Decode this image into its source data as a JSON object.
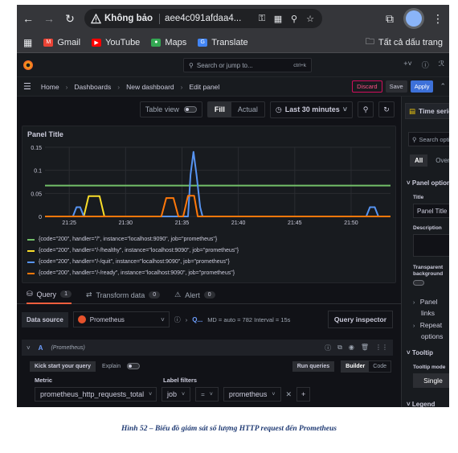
{
  "browser": {
    "security_label": "Không bảo",
    "url": "aee4c091afdaa4...",
    "icons": [
      "back-icon",
      "forward-icon",
      "reload-icon",
      "warning-icon",
      "key-icon",
      "translate-icon",
      "zoom-icon",
      "star-icon",
      "extensions-icon",
      "profile-icon",
      "menu-icon"
    ],
    "bookmarks": [
      {
        "label": "Gmail",
        "color": "#ea4335"
      },
      {
        "label": "YouTube",
        "color": "#ff0000"
      },
      {
        "label": "Maps",
        "color": "#34a853"
      },
      {
        "label": "Translate",
        "color": "#4285f4"
      }
    ],
    "all_bookmarks": "Tất cả dấu trang"
  },
  "grafana": {
    "search_placeholder": "Search or jump to...",
    "search_shortcut": "ctrl+k",
    "breadcrumb": [
      "Home",
      "Dashboards",
      "New dashboard",
      "Edit panel"
    ],
    "actions": {
      "discard": "Discard",
      "save": "Save",
      "apply": "Apply"
    }
  },
  "panel_toolbar": {
    "table_view": "Table view",
    "fill": "Fill",
    "actual": "Actual",
    "time_range": "Last 30 minutes"
  },
  "panel": {
    "title": "Panel Title"
  },
  "chart_data": {
    "type": "line",
    "title": "Panel Title",
    "y_ticks": [
      "0.15",
      "0.1",
      "0.05",
      "0"
    ],
    "x_ticks": [
      "21:25",
      "21:30",
      "21:35",
      "21:40",
      "21:45",
      "21:50"
    ],
    "ylim": [
      0,
      0.15
    ],
    "xlim": [
      0,
      28.5
    ],
    "grid": true,
    "legend_position": "bottom",
    "series": [
      {
        "name": "{code=\"200\", handler=\"/\", instance=\"localhost:9090\", job=\"prometheus\"}",
        "color": "#73bf69",
        "x": [
          0,
          28.5
        ],
        "y": [
          0.067,
          0.067
        ]
      },
      {
        "name": "{code=\"200\", handler=\"/-/healthy\", instance=\"localhost:9090\", job=\"prometheus\"}",
        "color": "#fade2a",
        "x": [
          0,
          3.2,
          3.6,
          4.5,
          4.9,
          9.3
        ],
        "y": [
          0,
          0,
          0.044,
          0.044,
          0,
          0
        ]
      },
      {
        "name": "{code=\"200\", handler=\"/-/quit\", instance=\"localhost:9090\", job=\"prometheus\"}",
        "color": "#5794f2",
        "x": [
          0,
          2.3,
          2.6,
          2.9,
          3.2,
          11.8,
          12.0,
          12.25,
          12.5,
          12.8,
          13.0,
          26.5,
          26.8,
          27.2,
          27.5,
          28.5
        ],
        "y": [
          0,
          0,
          0.02,
          0.02,
          0,
          0,
          0.09,
          0.14,
          0.09,
          0.02,
          0,
          0,
          0.02,
          0.02,
          0,
          0
        ]
      },
      {
        "name": "{code=\"200\", handler=\"/-/ready\", instance=\"localhost:9090\", job=\"prometheus\"}",
        "color": "#ff780a",
        "x": [
          0,
          9.6,
          10.0,
          10.6,
          11.0,
          11.4,
          11.8,
          12.3,
          12.6,
          28.5
        ],
        "y": [
          0,
          0,
          0.04,
          0.04,
          0,
          0,
          0.045,
          0.045,
          0,
          0
        ]
      }
    ]
  },
  "query_tabs": [
    {
      "label": "Query",
      "count": "1"
    },
    {
      "label": "Transform data",
      "count": "0"
    },
    {
      "label": "Alert",
      "count": "0"
    }
  ],
  "query": {
    "data_source_label": "Data source",
    "data_source": "Prometheus",
    "options_short": "Q...",
    "options_meta": "MD = auto = 782   Interval = 15s",
    "inspector": "Query inspector",
    "ref_id": "A",
    "ref_name": "(Prometheus)",
    "kick_start": "Kick start your query",
    "explain": "Explain",
    "run_queries": "Run queries",
    "builder": "Builder",
    "code": "Code",
    "metric_label": "Metric",
    "label_filters_label": "Label filters",
    "metric": "prometheus_http_requests_total",
    "filter_key": "job",
    "filter_op": "=",
    "filter_value": "prometheus"
  },
  "options_pane": {
    "visualization": "Time series",
    "search_placeholder": "Search optio",
    "tab_all": "All",
    "tab_overrides": "Overri",
    "panel_options": "Panel options",
    "title_label": "Title",
    "title_value": "Panel Title",
    "description_label": "Description",
    "transparent_line1": "Transparent",
    "transparent_line2": "background",
    "panel_links_1": "Panel",
    "panel_links_2": "links",
    "repeat_1": "Repeat",
    "repeat_2": "options",
    "tooltip": "Tooltip",
    "tooltip_mode": "Tooltip mode",
    "single": "Single",
    "legend": "Legend"
  },
  "caption": "Hình 52 – Biểu đồ giám sát số lượng HTTP request đến Prometheus"
}
